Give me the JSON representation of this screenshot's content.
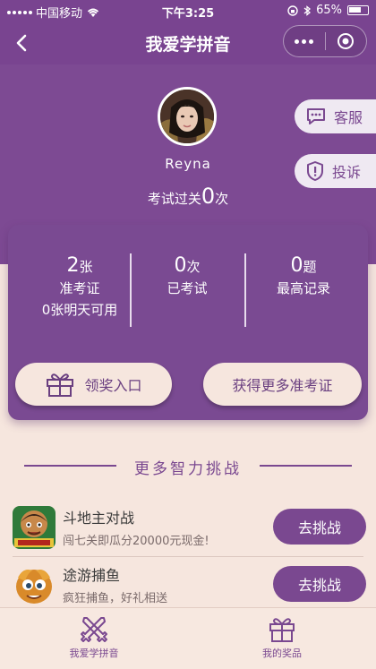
{
  "status_bar": {
    "carrier": "中国移动",
    "time": "下午3:25",
    "battery": "65%"
  },
  "nav": {
    "title": "我爱学拼音"
  },
  "profile": {
    "username": "Reyna",
    "exam_prefix": "考试过关",
    "exam_count": "0",
    "exam_suffix": "次"
  },
  "side_buttons": {
    "kefu": "客服",
    "tousu": "投诉"
  },
  "stats": {
    "tickets": {
      "value": "2",
      "unit": "张",
      "label": "准考证",
      "sub": "0张明天可用"
    },
    "exams": {
      "value": "0",
      "unit": "次",
      "label": "已考试"
    },
    "record": {
      "value": "0",
      "unit": "题",
      "label": "最高记录"
    }
  },
  "actions": {
    "prize_label": "领奖入口",
    "more_tickets_label": "获得更多准考证"
  },
  "section": {
    "title": "更多智力挑战"
  },
  "games": [
    {
      "name": "斗地主对战",
      "desc": "闯七关即瓜分20000元现金!",
      "button": "去挑战"
    },
    {
      "name": "途游捕鱼",
      "desc": "疯狂捕鱼，好礼相送",
      "button": "去挑战"
    }
  ],
  "tabs": [
    {
      "label": "我爱学拼音"
    },
    {
      "label": "我的奖品"
    }
  ],
  "colors": {
    "purple": "#7a4890",
    "cream": "#f6e6de"
  }
}
